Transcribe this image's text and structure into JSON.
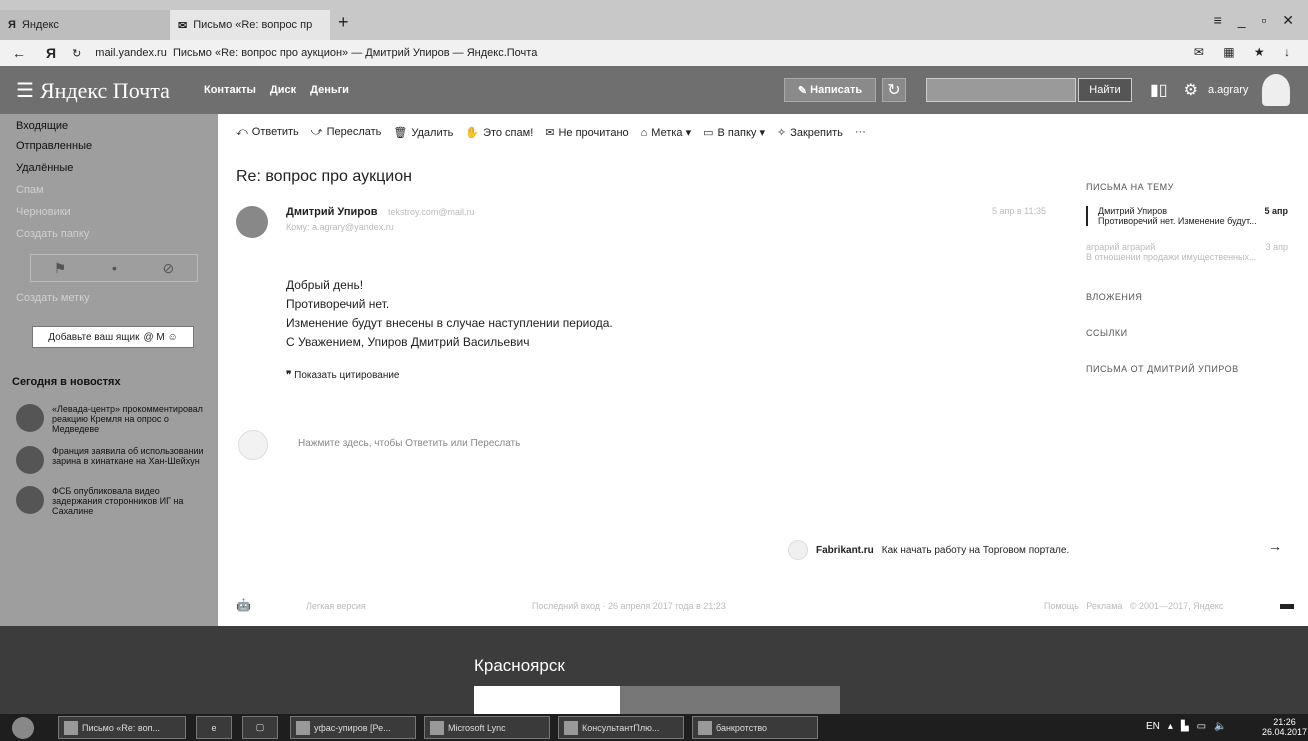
{
  "browser": {
    "tabs": [
      {
        "icon": "Я",
        "label": "Яндекс"
      },
      {
        "icon": "✉",
        "label": "Письмо «Re: вопрос пр"
      }
    ],
    "url_domain": "mail.yandex.ru",
    "url_title": "Письмо «Re: вопрос про аукцион» — Дмитрий Упиров — Яндекс.Почта"
  },
  "header": {
    "logo": "Яндекс Почта",
    "links": [
      "Контакты",
      "Диск",
      "Деньги"
    ],
    "compose_label": "Написать",
    "search_button": "Найти",
    "username": "a.agrary"
  },
  "sidebar": {
    "folders": [
      "Входящие",
      "Отправленные",
      "Удалённые",
      "Спам",
      "Черновики"
    ],
    "create_folder": "Создать папку",
    "create_label": "Создать метку",
    "add_mailbox": "Добавьте ваш ящик",
    "news_heading": "Сегодня в новостях",
    "news": [
      "«Левада-центр» прокомментировал реакцию Кремля на опрос о Медведеве",
      "Франция заявила об использовании зарина в хинаткане на Хан-Шейхун",
      "ФСБ опубликовала видео задержания сторонников ИГ на Сахалине"
    ]
  },
  "toolbar": {
    "reply": "Ответить",
    "forward": "Переслать",
    "delete": "Удалить",
    "spam": "Это спам!",
    "unread": "Не прочитано",
    "label": "Метка",
    "folder": "В папку",
    "pin": "Закрепить",
    "more": "···"
  },
  "message": {
    "subject": "Re: вопрос про аукцион",
    "sender": "Дмитрий Упиров",
    "sender_email": "tekstroy.com@mail.ru",
    "recipient": "Кому: a.agrary@yandex.ru",
    "date": "5 апр в 11:35",
    "body": [
      "Добрый день!",
      "Противоречий нет.",
      "Изменение будут внесены в случае наступлении периода.",
      "С Уважением, Упиров Дмитрий Васильевич"
    ],
    "show_quote": "Показать цитирование",
    "reply_hint": "Нажмите здесь, чтобы Ответить или Переслать"
  },
  "right_panel": {
    "thread_heading": "ПИСЬМА НА ТЕМУ",
    "thread": [
      {
        "from": "Дмитрий Упиров",
        "date": "5 апр",
        "snippet": "Противоречий нет. Изменение будут..."
      },
      {
        "from": "аграрий аграрий",
        "date": "3 апр",
        "snippet": "В отношении продажи имущественных..."
      }
    ],
    "attachments": "ВЛОЖЕНИЯ",
    "links": "ССЫЛКИ",
    "from_sender": "ПИСЬМА ОТ ДМИТРИЙ УПИРОВ"
  },
  "promo": {
    "brand": "Fabrikant.ru",
    "text": "Как начать работу на Торговом портале."
  },
  "footer": {
    "lite": "Легкая версия",
    "last_login": "Последний вход · 26 апреля 2017 года в 21:23",
    "help": "Помощь",
    "ads": "Реклама",
    "copyright": "© 2001—2017, Яндекс"
  },
  "weather": {
    "city": "Красноярск"
  },
  "taskbar": {
    "items": [
      "Письмо «Re: воп...",
      "",
      "",
      "уфас-упиров [Ре...",
      "Microsoft Lync",
      "КонсультантПлю...",
      "банкротство"
    ],
    "lang": "EN",
    "time": "21:26",
    "date": "26.04.2017"
  }
}
